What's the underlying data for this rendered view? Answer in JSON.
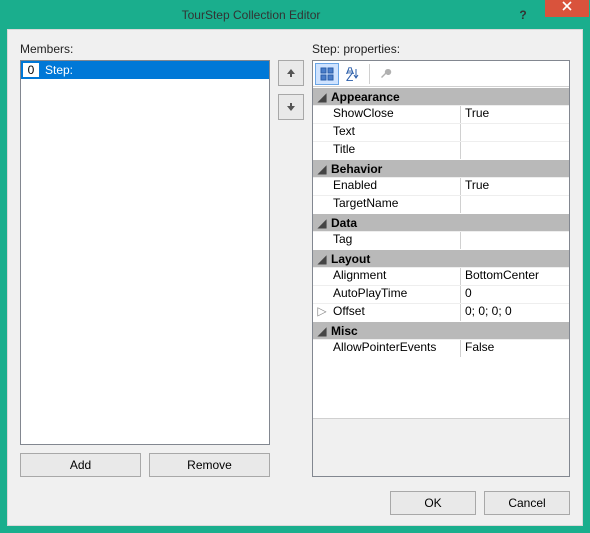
{
  "window": {
    "title": "TourStep Collection Editor"
  },
  "left": {
    "label": "Members:",
    "items": [
      {
        "index": "0",
        "name": "Step:"
      }
    ],
    "add": "Add",
    "remove": "Remove"
  },
  "right": {
    "label": "Step: properties:",
    "categories": [
      {
        "name": "Appearance",
        "props": [
          {
            "name": "ShowClose",
            "value": "True"
          },
          {
            "name": "Text",
            "value": ""
          },
          {
            "name": "Title",
            "value": ""
          }
        ]
      },
      {
        "name": "Behavior",
        "props": [
          {
            "name": "Enabled",
            "value": "True"
          },
          {
            "name": "TargetName",
            "value": ""
          }
        ]
      },
      {
        "name": "Data",
        "props": [
          {
            "name": "Tag",
            "value": ""
          }
        ]
      },
      {
        "name": "Layout",
        "props": [
          {
            "name": "Alignment",
            "value": "BottomCenter"
          },
          {
            "name": "AutoPlayTime",
            "value": "0"
          },
          {
            "name": "Offset",
            "value": "0; 0; 0; 0",
            "expandable": true
          }
        ]
      },
      {
        "name": "Misc",
        "props": [
          {
            "name": "AllowPointerEvents",
            "value": "False"
          }
        ]
      }
    ]
  },
  "footer": {
    "ok": "OK",
    "cancel": "Cancel"
  }
}
